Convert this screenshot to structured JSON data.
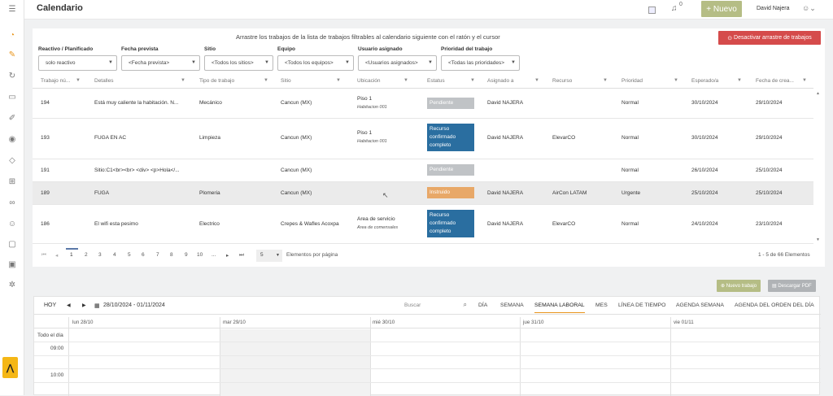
{
  "app": {
    "title": "Calendario"
  },
  "topbar": {
    "bell_count": "0",
    "new_label": "+ Nuevo",
    "user_name": "David Najera"
  },
  "panel": {
    "drag_hint": "Arrastre los trabajos de la lista de trabajos filtrables al calendario siguiente con el ratón y el cursor",
    "deactivate_label": "Desactivar arrastre de trabajos"
  },
  "filters": [
    {
      "label": "Reactivo / Planificado",
      "value": "solo reactivo"
    },
    {
      "label": "Fecha prevista",
      "value": "<Fecha prevista>"
    },
    {
      "label": "Sitio",
      "value": "<Todos los sitios>"
    },
    {
      "label": "Equipo",
      "value": "<Todos los equipos>"
    },
    {
      "label": "Usuario asignado",
      "value": "<Usuarios asignados>"
    },
    {
      "label": "Prioridad del trabajo",
      "value": "<Todas las prioridades>"
    }
  ],
  "columns": [
    "Trabajo nú...",
    "Detalles",
    "Tipo de trabajo",
    "Sitio",
    "Ubicación",
    "Estatus",
    "Asignado a",
    "Recurso",
    "Prioridad",
    "Esperado/a",
    "Fecha de crea..."
  ],
  "rows": [
    {
      "num": "194",
      "details": "Está muy caliente la habitación. N...",
      "type": "Mecánico",
      "site": "Cancun (MX)",
      "loc": "Piso 1",
      "loc_sub": "Habitacion 001",
      "status": "Pendiente",
      "status_color": "#c0c3c6",
      "assigned": "David NAJERA",
      "resource": "",
      "priority": "Normal",
      "expected": "30/10/2024",
      "created": "29/10/2024"
    },
    {
      "num": "193",
      "details": "FUGA EN AC",
      "type": "Limpieza",
      "site": "Cancun (MX)",
      "loc": "Piso 1",
      "loc_sub": "Habitacion 001",
      "status": "Recurso confirmado completo",
      "status_color": "#2a6ea0",
      "assigned": "David NAJERA",
      "resource": "ElevarCO",
      "priority": "Normal",
      "expected": "30/10/2024",
      "created": "29/10/2024"
    },
    {
      "num": "191",
      "details": "Sitio:C1<br><br> <div> <p>Hola</...",
      "type": "",
      "site": "Cancun (MX)",
      "loc": "",
      "loc_sub": "",
      "status": "Pendiente",
      "status_color": "#c0c3c6",
      "assigned": "",
      "resource": "",
      "priority": "Normal",
      "expected": "26/10/2024",
      "created": "25/10/2024"
    },
    {
      "num": "189",
      "details": "FUGA",
      "type": "Plomeria",
      "site": "Cancun (MX)",
      "loc": "",
      "loc_sub": "",
      "status": "Instruido",
      "status_color": "#e8a868",
      "assigned": "David NAJERA",
      "resource": "AirCon LATAM",
      "priority": "Urgente",
      "expected": "25/10/2024",
      "created": "25/10/2024"
    },
    {
      "num": "186",
      "details": "El wifi esta pesimo",
      "type": "Electrico",
      "site": "Crepes & Wafles Acoxpa",
      "loc": "Area de servicio",
      "loc_sub": "Area de comensales",
      "status": "Recurso confirmado completo",
      "status_color": "#2a6ea0",
      "assigned": "David NAJERA",
      "resource": "ElevarCO",
      "priority": "Normal",
      "expected": "24/10/2024",
      "created": "23/10/2024"
    }
  ],
  "pager": {
    "pages": [
      "1",
      "2",
      "3",
      "4",
      "5",
      "6",
      "7",
      "8",
      "9",
      "10",
      "..."
    ],
    "page_size": "5",
    "per_page_label": "Elementos por página",
    "summary": "1 - 5 de 66 Elementos"
  },
  "calendar": {
    "new_job_label": "Nuevo trabajo",
    "pdf_label": "Descargar PDF",
    "today_label": "HOY",
    "range": "28/10/2024 - 01/11/2024",
    "search_placeholder": "Buscar",
    "views": [
      "DÍA",
      "SEMANA",
      "SEMANA LABORAL",
      "MES",
      "LÍNEA DE TIEMPO",
      "AGENDA SEMANA",
      "AGENDA DEL ORDEN DEL DÍA"
    ],
    "active_view": "SEMANA LABORAL",
    "days": [
      "lun 28/10",
      "mar 29/10",
      "mié 30/10",
      "jue 31/10",
      "vie 01/11"
    ],
    "all_day_label": "Todo el día",
    "times": [
      "09:00",
      "10:00"
    ]
  }
}
